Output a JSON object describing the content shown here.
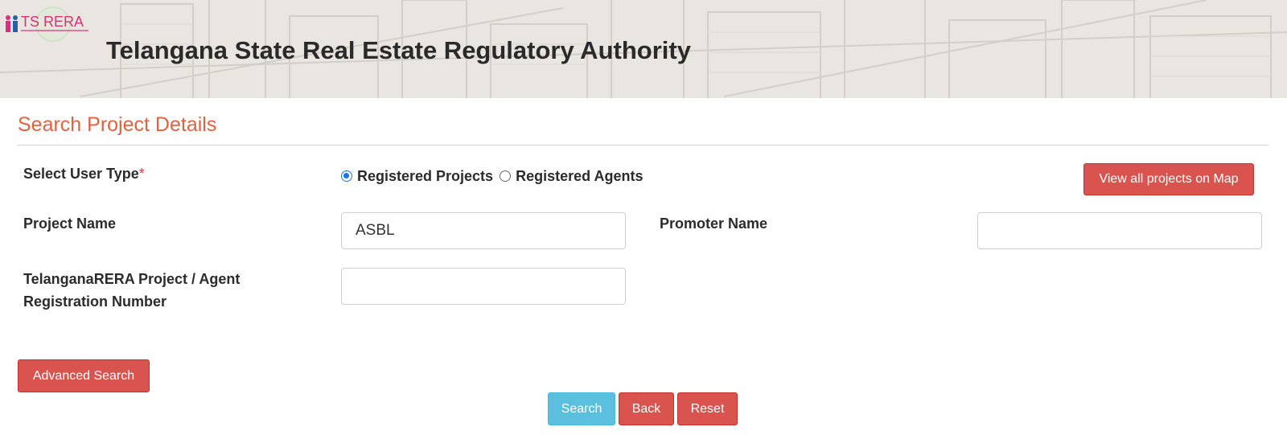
{
  "header": {
    "logo_text": "TS RERA",
    "title": "Telangana State Real Estate Regulatory Authority"
  },
  "section": {
    "title": "Search Project Details"
  },
  "form": {
    "user_type_label": "Select User Type",
    "required_mark": "*",
    "radio_options": [
      {
        "label": "Registered Projects",
        "checked": true
      },
      {
        "label": "Registered Agents",
        "checked": false
      }
    ],
    "project_name_label": "Project Name",
    "project_name_value": "ASBL",
    "promoter_name_label": "Promoter Name",
    "promoter_name_value": "",
    "reg_number_label_line1": "TelanganaRERA Project / Agent",
    "reg_number_label_line2": "Registration Number",
    "reg_number_value": ""
  },
  "buttons": {
    "view_map": "View all projects on Map",
    "advanced_search": "Advanced Search",
    "search": "Search",
    "back": "Back",
    "reset": "Reset"
  },
  "colors": {
    "accent_title": "#e4603e",
    "btn_red": "#d9534f",
    "btn_blue": "#5bc0de",
    "logo_pink": "#d6317a"
  }
}
